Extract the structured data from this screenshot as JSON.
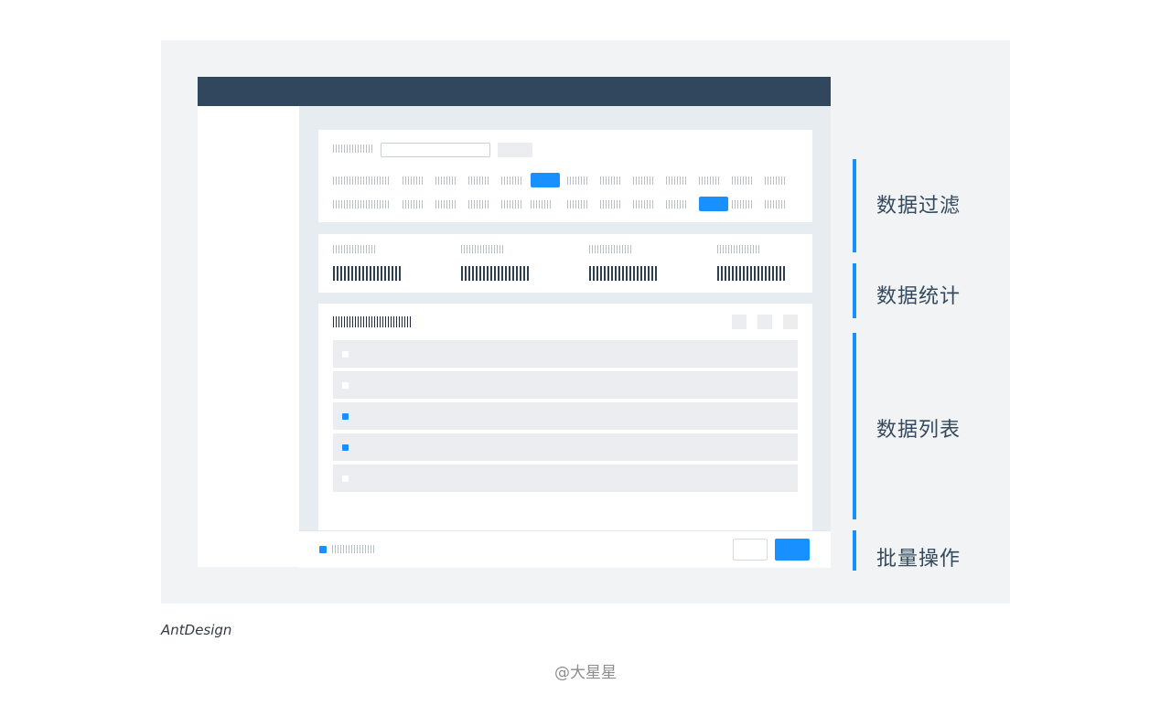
{
  "sections": {
    "filter_label": "数据过滤",
    "stats_label": "数据统计",
    "list_label": "数据列表",
    "batch_label": "批量操作"
  },
  "brand": "AntDesign",
  "watermark": "@大星星",
  "colors": {
    "accent": "#1890ff",
    "header": "#31475e",
    "panel": "#f1f3f5",
    "text": "#34495e"
  },
  "list": {
    "rows_checked": [
      false,
      false,
      true,
      true,
      false
    ]
  },
  "filter": {
    "row1_selected_index": 5,
    "row2_selected_index": 10
  }
}
